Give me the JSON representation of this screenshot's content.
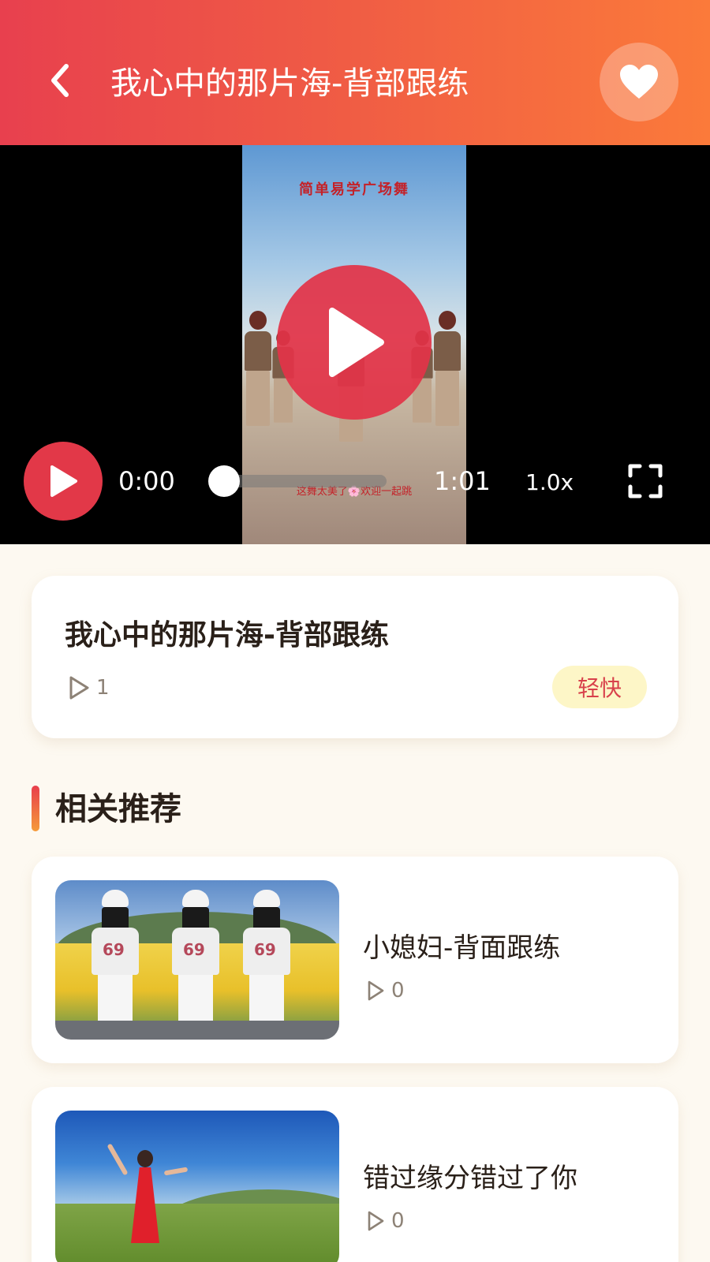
{
  "header": {
    "title": "我心中的那片海-背部跟练",
    "back_icon": "chevron-left-icon",
    "favorite_icon": "heart-icon"
  },
  "player": {
    "caption_top": "简单易学广场舞",
    "caption_bottom": "这舞太美了🌸欢迎一起跳",
    "current_time": "0:00",
    "total_time": "1:01",
    "speed": "1.0x",
    "progress": 0,
    "play_icon": "play-icon",
    "fullscreen_icon": "fullscreen-icon"
  },
  "info": {
    "title": "我心中的那片海-背部跟练",
    "plays": "1",
    "tag": "轻快"
  },
  "section": {
    "title": "相关推荐"
  },
  "recommendations": [
    {
      "title": "小媳妇-背面跟练",
      "plays": "0"
    },
    {
      "title": "错过缘分错过了你",
      "plays": "0"
    }
  ],
  "colors": {
    "header_start": "#e8404e",
    "header_end": "#fb7a3a",
    "accent": "#e23848",
    "tag_bg": "#fdf6c7",
    "tag_text": "#d8414b",
    "page_bg": "#fdf9f1"
  }
}
